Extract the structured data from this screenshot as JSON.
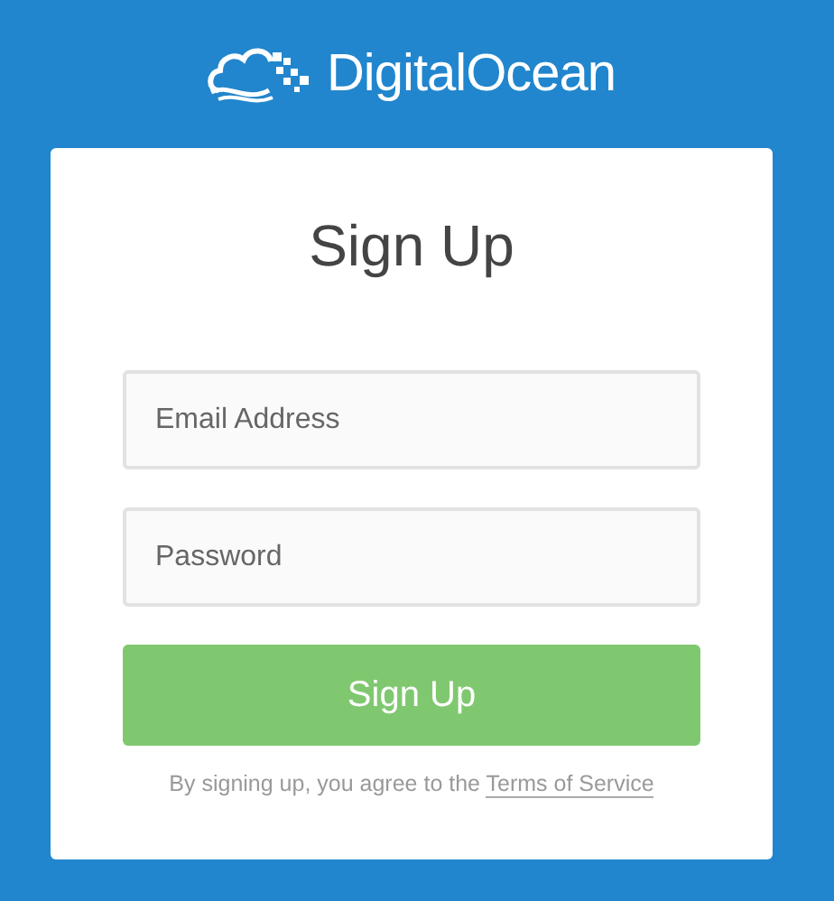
{
  "brand": {
    "name": "DigitalOcean"
  },
  "form": {
    "title": "Sign Up",
    "fields": [
      {
        "placeholder": "Email Address"
      },
      {
        "placeholder": "Password"
      }
    ],
    "submit": "Sign Up",
    "terms": {
      "text": "By signing up, you agree to the",
      "link": "Terms of Service"
    }
  }
}
